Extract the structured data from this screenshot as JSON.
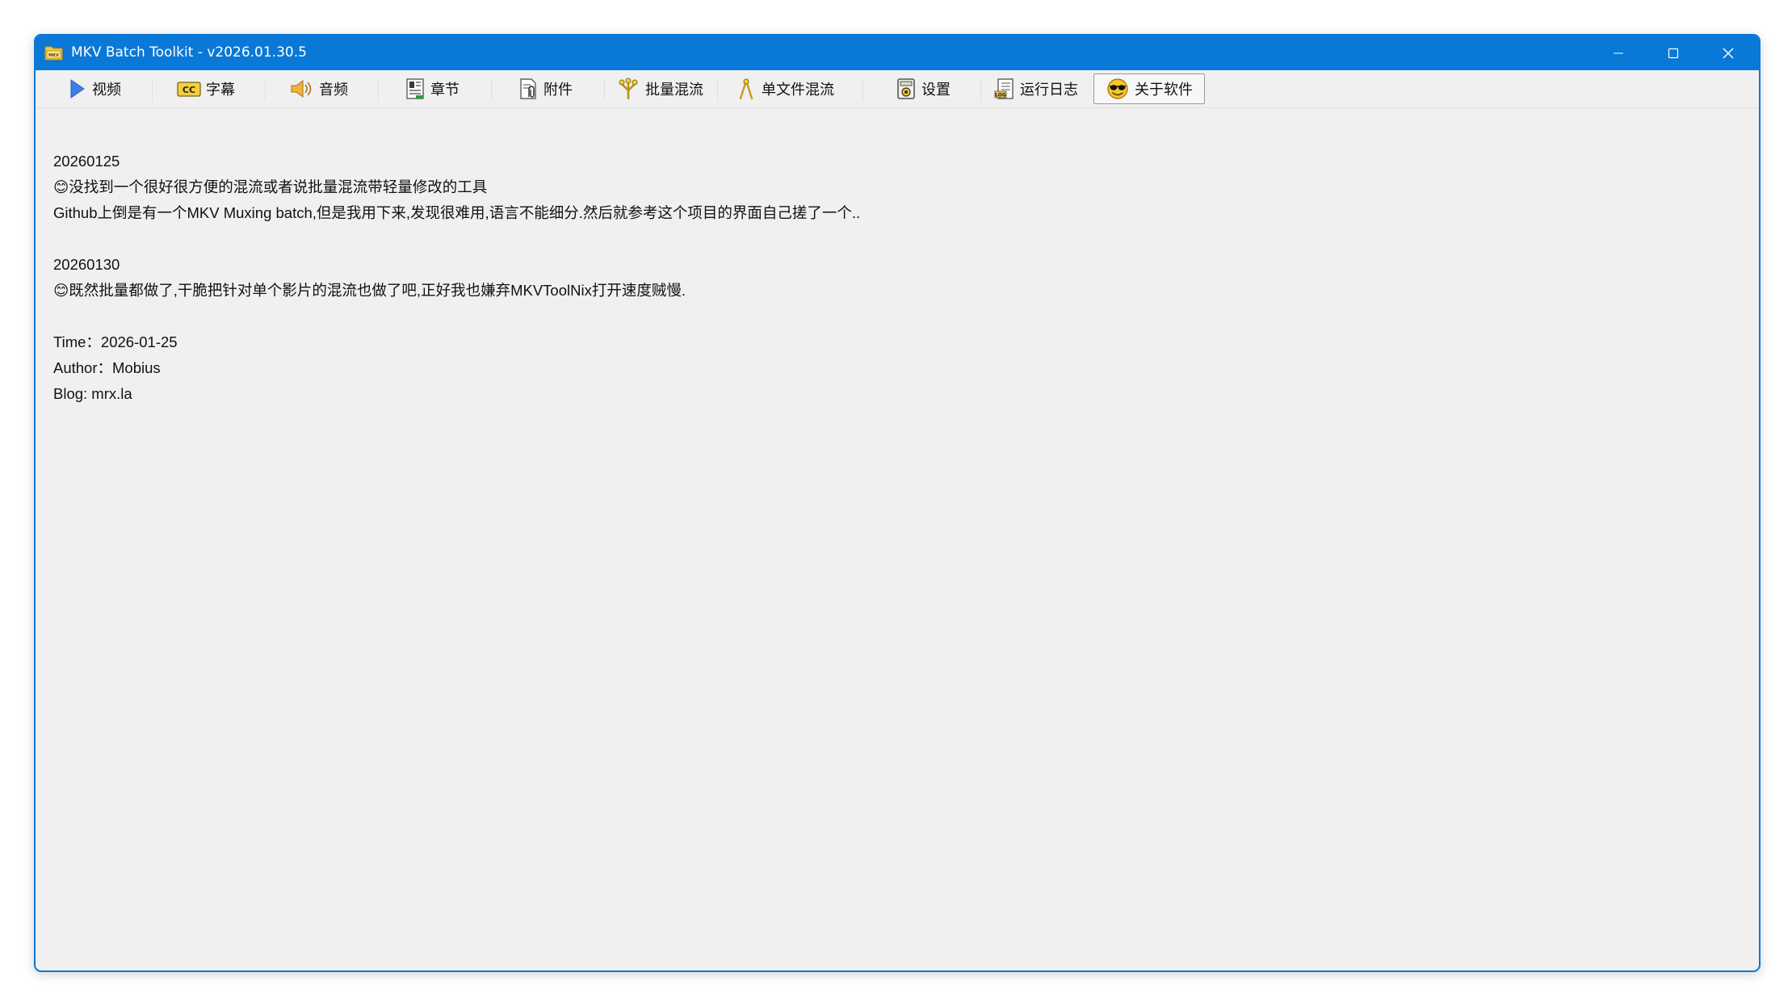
{
  "window": {
    "title": "MKV Batch Toolkit - v2026.01.30.5",
    "icon": "mkv-folder-icon",
    "accent_color": "#0a78d7"
  },
  "toolbar": {
    "tabs": [
      {
        "label": "视频",
        "icon": "play-icon"
      },
      {
        "label": "字幕",
        "icon": "cc-icon"
      },
      {
        "label": "音频",
        "icon": "speaker-icon"
      },
      {
        "label": "章节",
        "icon": "chapter-icon"
      },
      {
        "label": "附件",
        "icon": "attachment-icon"
      },
      {
        "label": "批量混流",
        "icon": "batch-merge-icon"
      },
      {
        "label": "单文件混流",
        "icon": "single-merge-icon"
      },
      {
        "label": "设置",
        "icon": "settings-icon"
      },
      {
        "label": "运行日志",
        "icon": "log-icon"
      },
      {
        "label": "关于软件",
        "icon": "smiley-sunglasses-icon",
        "active": true
      }
    ]
  },
  "about": {
    "entry1_date": "20260125",
    "entry1_line1": "😊没找到一个很好很方便的混流或者说批量混流带轻量修改的工具",
    "entry1_line2": "Github上倒是有一个MKV Muxing batch,但是我用下来,发现很难用,语言不能细分.然后就参考这个项目的界面自己搓了一个..",
    "entry2_date": "20260130",
    "entry2_line1": "😊既然批量都做了,干脆把针对单个影片的混流也做了吧,正好我也嫌弃MKVToolNix打开速度贼慢.",
    "time": "Time：2026-01-25",
    "author": "Author：Mobius",
    "blog": "Blog: mrx.la"
  }
}
